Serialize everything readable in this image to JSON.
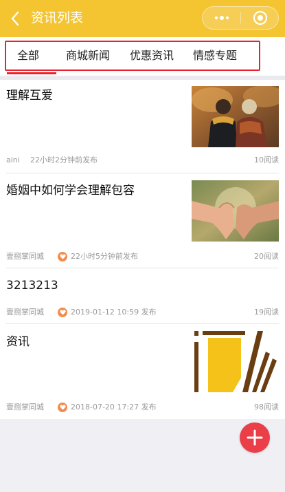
{
  "header": {
    "title": "资讯列表",
    "back_icon": "chevron-left-icon",
    "more_icon": "ellipsis-icon",
    "close_icon": "target-circle-icon"
  },
  "tabs": [
    {
      "label": "全部",
      "active": true
    },
    {
      "label": "商城新闻",
      "active": false
    },
    {
      "label": "优惠资讯",
      "active": false
    },
    {
      "label": "情感专题",
      "active": false
    }
  ],
  "articles": [
    {
      "title": "理解互爱",
      "author": "aini",
      "time": "22小时2分钟前发布",
      "reads": "10阅读",
      "has_heart": false,
      "image": "couple-autumn-photo"
    },
    {
      "title": "婚姻中如何学会理解包容",
      "author": "壹捌掌同城",
      "time": "22小时5分钟前发布",
      "reads": "20阅读",
      "has_heart": true,
      "image": "heart-hands-photo"
    },
    {
      "title": "3213213",
      "author": "壹捌掌同城",
      "time": "2019-01-12 10:59 发布",
      "reads": "19阅读",
      "has_heart": true,
      "image": ""
    },
    {
      "title": "资讯",
      "author": "壹捌掌同城",
      "time": "2018-07-20 17:27 发布",
      "reads": "98阅读",
      "has_heart": true,
      "image": "yellow-brown-graphic"
    }
  ],
  "fab": {
    "icon": "plus-icon"
  },
  "colors": {
    "topbar": "#f4c431",
    "accent": "#e8232f",
    "fab": "#ea3f49",
    "heart_badge": "#f58b4c"
  }
}
